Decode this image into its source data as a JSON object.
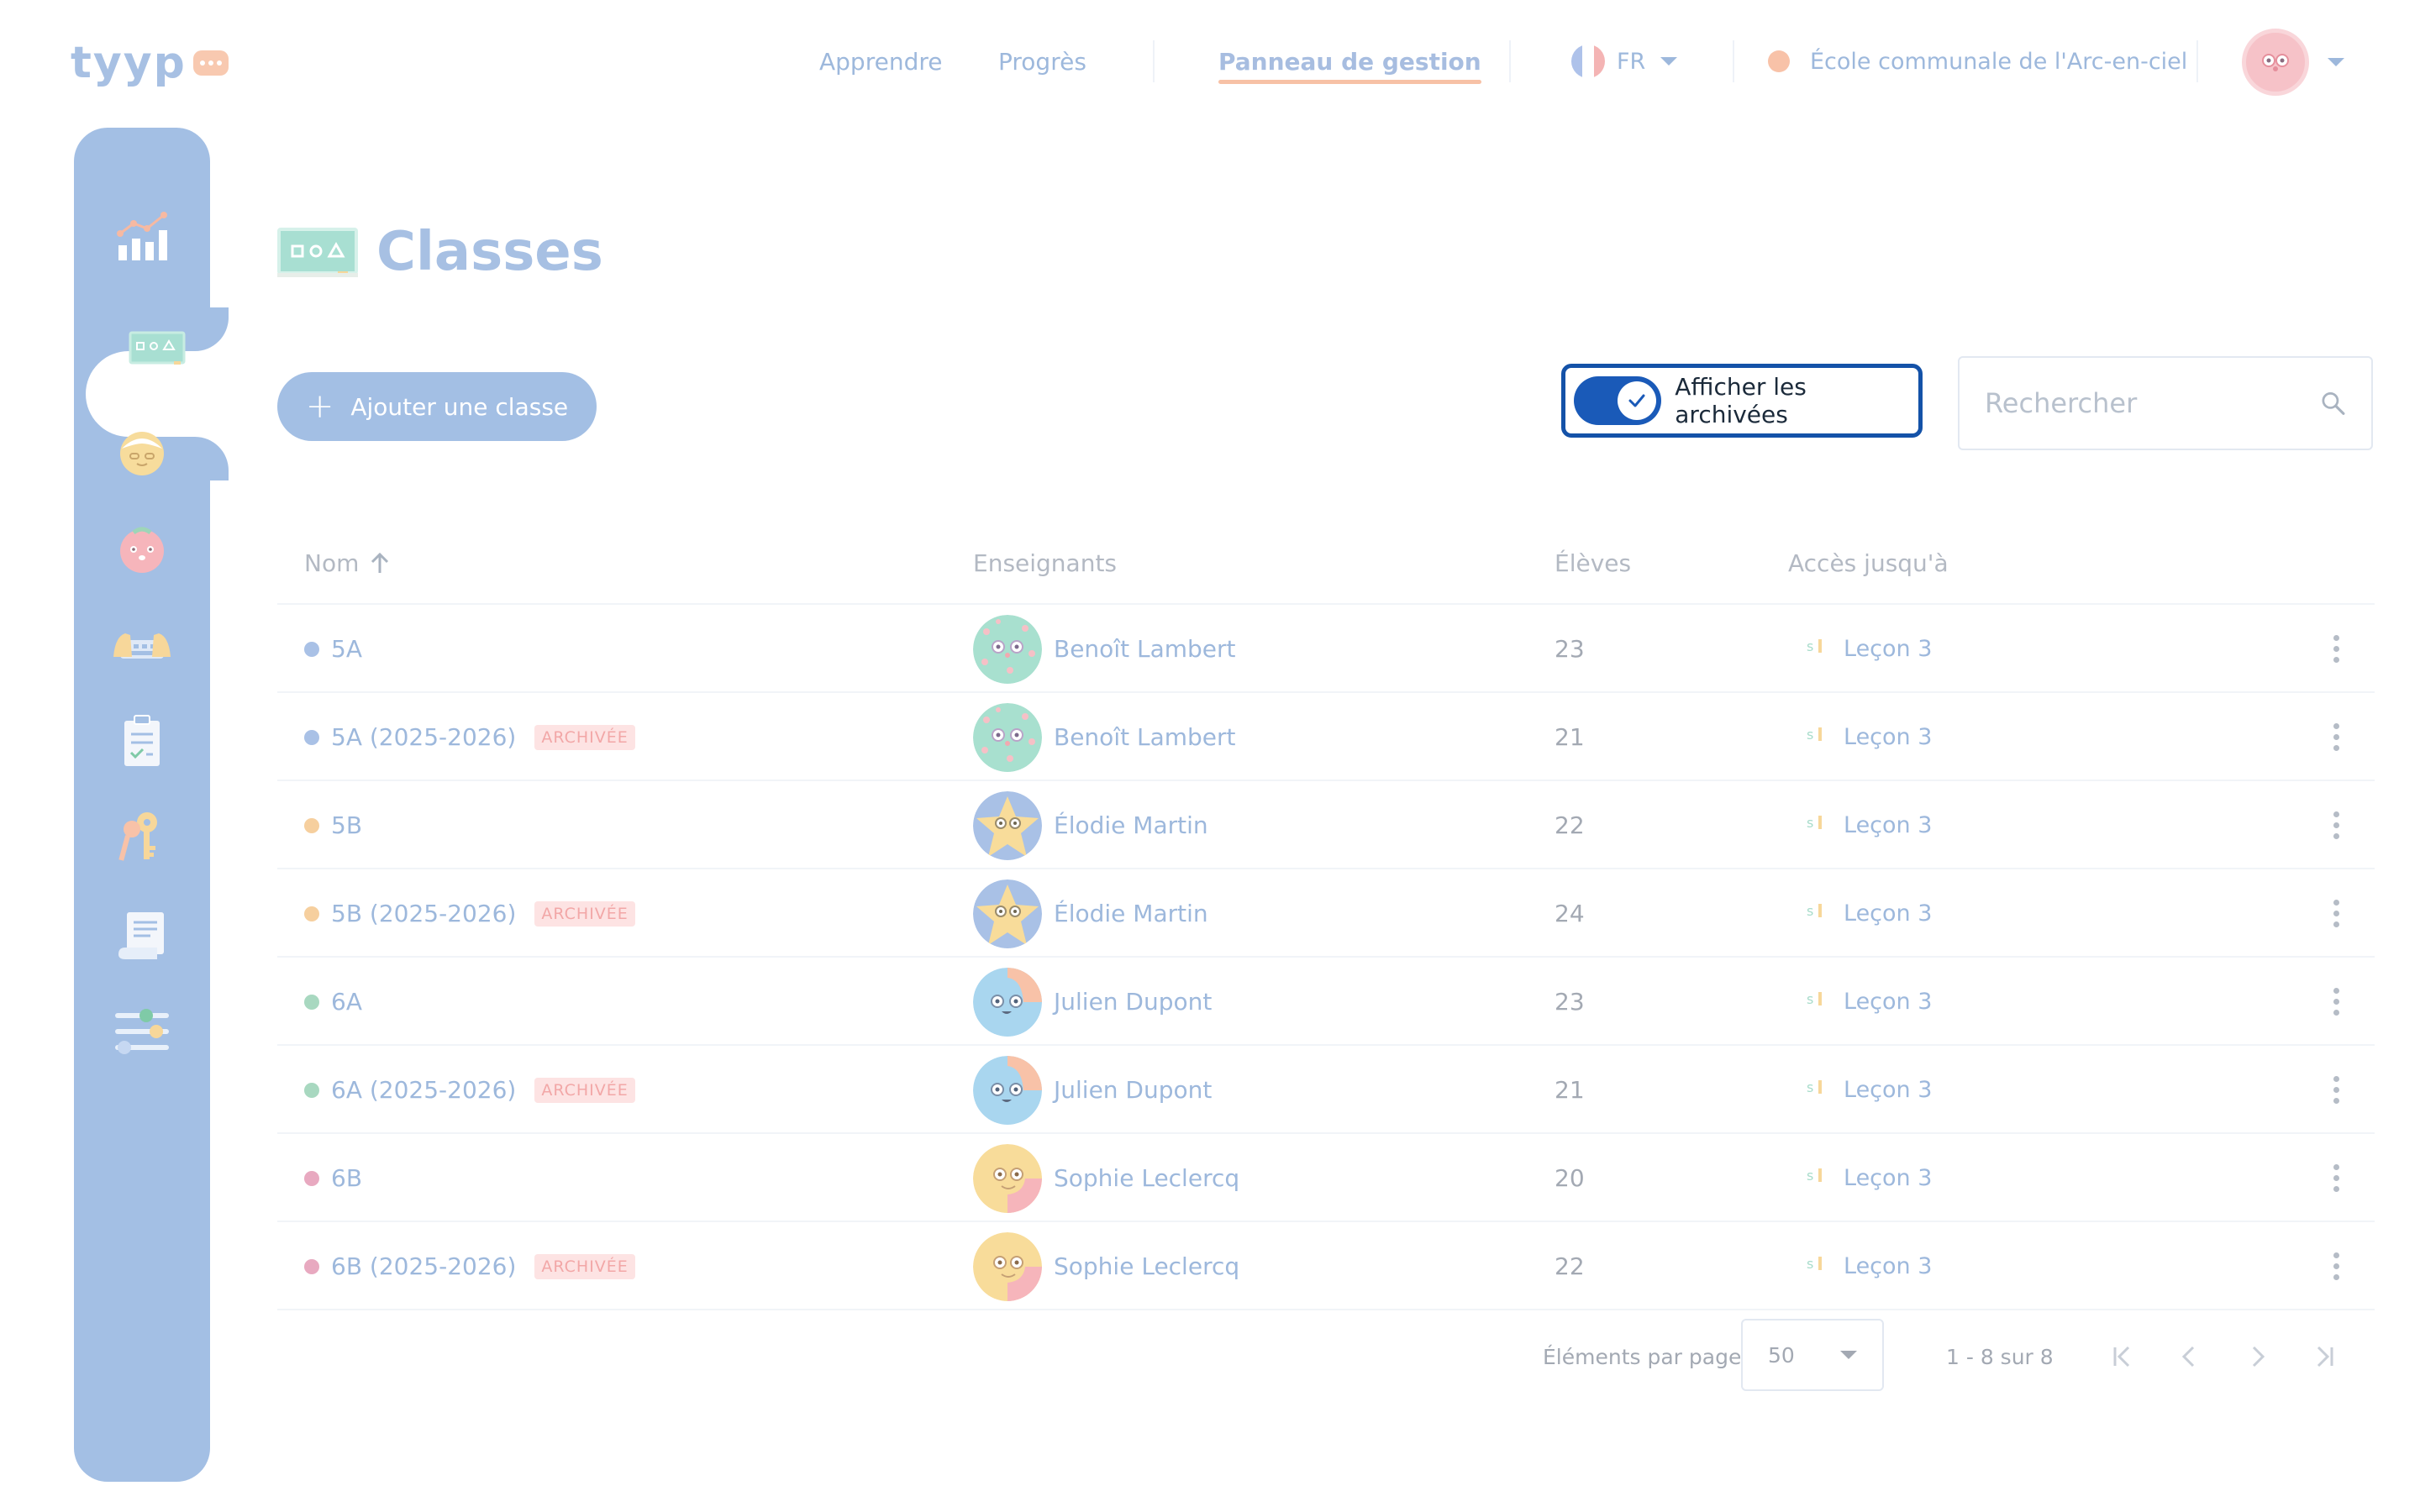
{
  "app": {
    "logo": "tyyp"
  },
  "nav": {
    "learn": "Apprendre",
    "progress": "Progrès",
    "admin": "Panneau de gestion",
    "language": "FR",
    "school": "École communale de l'Arc-en-ciel"
  },
  "sidebar": {
    "items": [
      {
        "icon": "chart-icon"
      },
      {
        "icon": "chalkboard-icon",
        "active": true
      },
      {
        "icon": "teacher-avatar-icon"
      },
      {
        "icon": "student-avatar-icon"
      },
      {
        "icon": "keyboard-hands-icon"
      },
      {
        "icon": "clipboard-icon"
      },
      {
        "icon": "keys-icon"
      },
      {
        "icon": "receipt-icon"
      },
      {
        "icon": "settings-sliders-icon"
      }
    ]
  },
  "page": {
    "title": "Classes",
    "add_button": "Ajouter une classe",
    "archive_toggle": "Afficher les archivées",
    "search_placeholder": "Rechercher"
  },
  "table": {
    "headers": {
      "name": "Nom",
      "teachers": "Enseignants",
      "students": "Élèves",
      "access": "Accès jusqu'à"
    },
    "archived_badge": "ARCHIVÉE",
    "rows": [
      {
        "name": "5A",
        "archived": false,
        "dot": "#a9c1e6",
        "teacher": "Benoît Lambert",
        "avatar": "green",
        "students": "23",
        "access": "Leçon 3"
      },
      {
        "name": "5A (2025-2026)",
        "archived": true,
        "dot": "#a9c1e6",
        "teacher": "Benoît Lambert",
        "avatar": "green",
        "students": "21",
        "access": "Leçon 3"
      },
      {
        "name": "5B",
        "archived": false,
        "dot": "#f6cf9e",
        "teacher": "Élodie Martin",
        "avatar": "star",
        "students": "22",
        "access": "Leçon 3"
      },
      {
        "name": "5B (2025-2026)",
        "archived": true,
        "dot": "#f6cf9e",
        "teacher": "Élodie Martin",
        "avatar": "star",
        "students": "24",
        "access": "Leçon 3"
      },
      {
        "name": "6A",
        "archived": false,
        "dot": "#a8d8c0",
        "teacher": "Julien Dupont",
        "avatar": "blue",
        "students": "23",
        "access": "Leçon 3"
      },
      {
        "name": "6A (2025-2026)",
        "archived": true,
        "dot": "#a8d8c0",
        "teacher": "Julien Dupont",
        "avatar": "blue",
        "students": "21",
        "access": "Leçon 3"
      },
      {
        "name": "6B",
        "archived": false,
        "dot": "#e8a9c0",
        "teacher": "Sophie Leclercq",
        "avatar": "yellow",
        "students": "20",
        "access": "Leçon 3"
      },
      {
        "name": "6B (2025-2026)",
        "archived": true,
        "dot": "#e8a9c0",
        "teacher": "Sophie Leclercq",
        "avatar": "yellow",
        "students": "22",
        "access": "Leçon 3"
      }
    ]
  },
  "pagination": {
    "per_page_label": "Éléments par page",
    "per_page": "50",
    "range": "1 - 8 sur 8"
  },
  "colors": {
    "primary": "#a3bfe4",
    "toggle": "#1a5ab8",
    "accent": "#f7c1a6",
    "archived": "#f2a7a7"
  }
}
